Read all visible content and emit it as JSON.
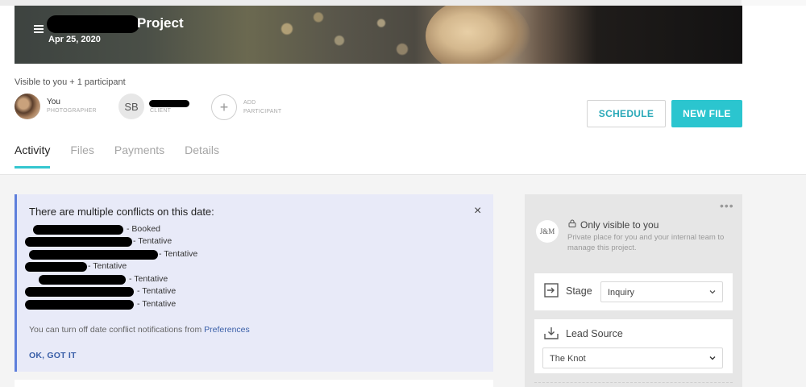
{
  "header": {
    "project_title": "Project",
    "date": "Apr 25, 2020"
  },
  "participants": {
    "visibility": "Visible to you + 1 participant",
    "you": {
      "name": "You",
      "role": "PHOTOGRAPHER"
    },
    "client": {
      "initials": "SB",
      "role": "CLIENT"
    },
    "add": {
      "symbol": "+",
      "line1": "ADD",
      "line2": "PARTICIPANT"
    }
  },
  "actions": {
    "schedule": "SCHEDULE",
    "new_file": "NEW FILE"
  },
  "tabs": [
    {
      "label": "Activity",
      "active": true
    },
    {
      "label": "Files"
    },
    {
      "label": "Payments"
    },
    {
      "label": "Details"
    }
  ],
  "conflict_notice": {
    "title": "There are multiple conflicts on this date:",
    "close": "×",
    "items": [
      {
        "status": "-  Booked"
      },
      {
        "status": "-  Tentative"
      },
      {
        "status": "-  Tentative"
      },
      {
        "status": "-  Tentative"
      },
      {
        "status": "-  Tentative"
      },
      {
        "status": "-  Tentative"
      },
      {
        "status": "-  Tentative"
      }
    ],
    "note_prefix": "You can turn off date conflict notifications from ",
    "note_link": "Preferences",
    "ok": "OK, GOT IT"
  },
  "sidebar": {
    "more": "•••",
    "company_initials": "J&M",
    "only_visible": "Only visible to you",
    "private_note": "Private place for you and your internal team to manage this project.",
    "stage": {
      "label": "Stage",
      "value": "Inquiry"
    },
    "lead_source": {
      "label": "Lead Source",
      "value": "The Knot"
    }
  },
  "colors": {
    "accent": "#2bc5cf",
    "tab_underline": "#34c6cf",
    "notice_bg": "#e8eaf8",
    "notice_border": "#5e7fdc",
    "link": "#3a5fa8"
  }
}
